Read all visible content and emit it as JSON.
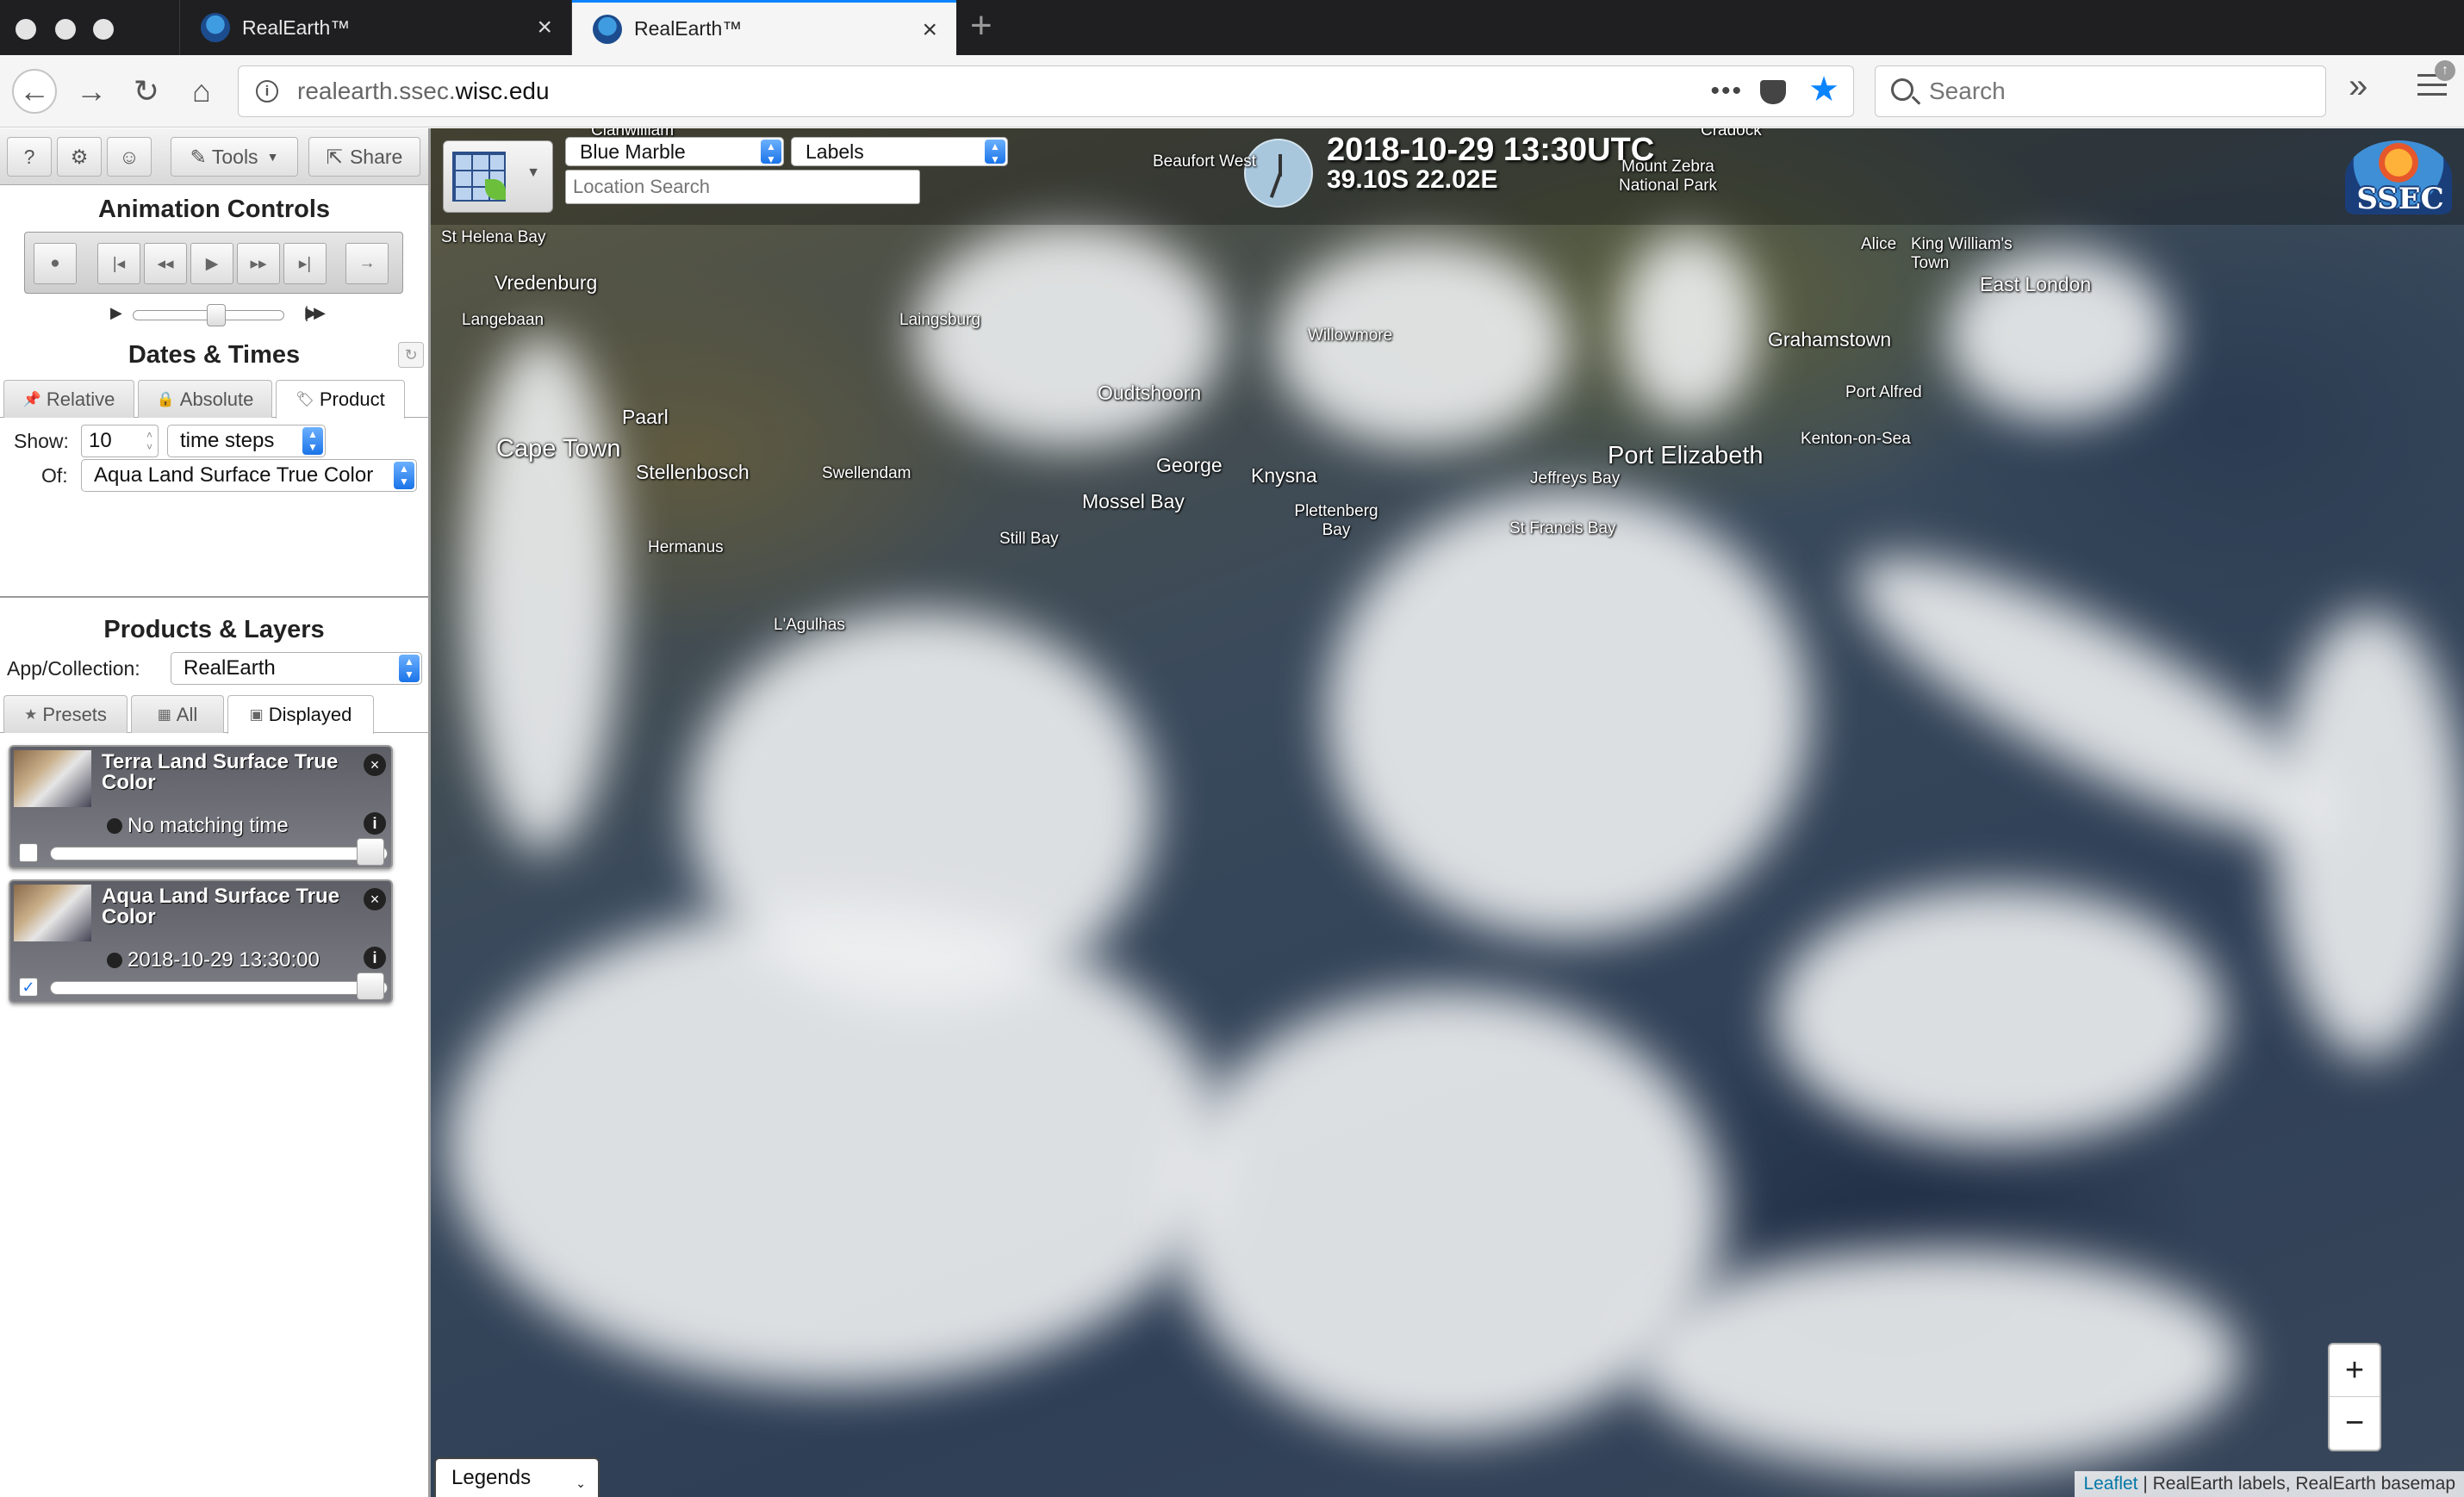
{
  "browser": {
    "tabs": [
      {
        "title": "RealEarth™",
        "active": false
      },
      {
        "title": "RealEarth™",
        "active": true
      }
    ],
    "url_host_prefix": "realearth.ssec.",
    "url_host_domain": "wisc.edu",
    "search_placeholder": "Search",
    "menu_badge": "↑"
  },
  "toolbar": {
    "help_label": "?",
    "tools_label": "Tools",
    "share_label": "Share"
  },
  "animation": {
    "heading": "Animation Controls",
    "speed_fraction": 0.55
  },
  "dates": {
    "heading": "Dates & Times",
    "tabs": [
      "Relative",
      "Absolute",
      "Product"
    ],
    "selected_tab": "Product",
    "show_label": "Show:",
    "show_value": "10",
    "unit_value": "time steps",
    "of_label": "Of:",
    "of_value": "Aqua Land Surface True Color"
  },
  "products": {
    "heading": "Products & Layers",
    "collection_label": "App/Collection:",
    "collection_value": "RealEarth",
    "tabs": [
      "Presets",
      "All",
      "Displayed"
    ],
    "selected_tab": "Displayed",
    "layers": [
      {
        "title": "Terra Land Surface True Color",
        "status": "No matching time",
        "checked": false,
        "opacity": 1.0
      },
      {
        "title": "Aqua Land Surface True Color",
        "status": "2018-10-29 13:30:00",
        "checked": true,
        "opacity": 1.0
      }
    ]
  },
  "map": {
    "basemap_value": "Blue Marble",
    "labels_value": "Labels",
    "location_placeholder": "Location Search",
    "datetime": "2018-10-29 13:30UTC",
    "coords": "39.10S 22.02E",
    "logo_text": "SSEC",
    "legends_label": "Legends",
    "zoom_in": "+",
    "zoom_out": "−",
    "attribution_link": "Leaflet",
    "attribution_text": " | RealEarth labels, RealEarth basemap",
    "places": {
      "chanwilliam": "Clanwilliam",
      "st_helena": "St Helena Bay",
      "vredenburg": "Vredenburg",
      "langebaan": "Langebaan",
      "paarl": "Paarl",
      "cape_town": "Cape Town",
      "stellenbosch": "Stellenbosch",
      "hermanus": "Hermanus",
      "laingsburg": "Laingsburg",
      "swellendam": "Swellendam",
      "agulhas": "L'Agulhas",
      "still_bay": "Still Bay",
      "oudtshoorn": "Oudtshoorn",
      "george": "George",
      "mossel_bay": "Mossel Bay",
      "knysna": "Knysna",
      "plettenberg": "Plettenberg Bay",
      "willowmore": "Willowmore",
      "beaufort": "Beaufort West",
      "cradock": "Cradock",
      "mountain_zebra": "Mount Zebra National Park",
      "port_elizabeth": "Port Elizabeth",
      "jeffreys": "Jeffreys Bay",
      "st_francis": "St Francis Bay",
      "grahamstown": "Grahamstown",
      "port_alfred": "Port Alfred",
      "kenton": "Kenton-on-Sea",
      "alice": "Alice",
      "kingwilliams": "King William's Town",
      "east_london": "East London"
    }
  }
}
